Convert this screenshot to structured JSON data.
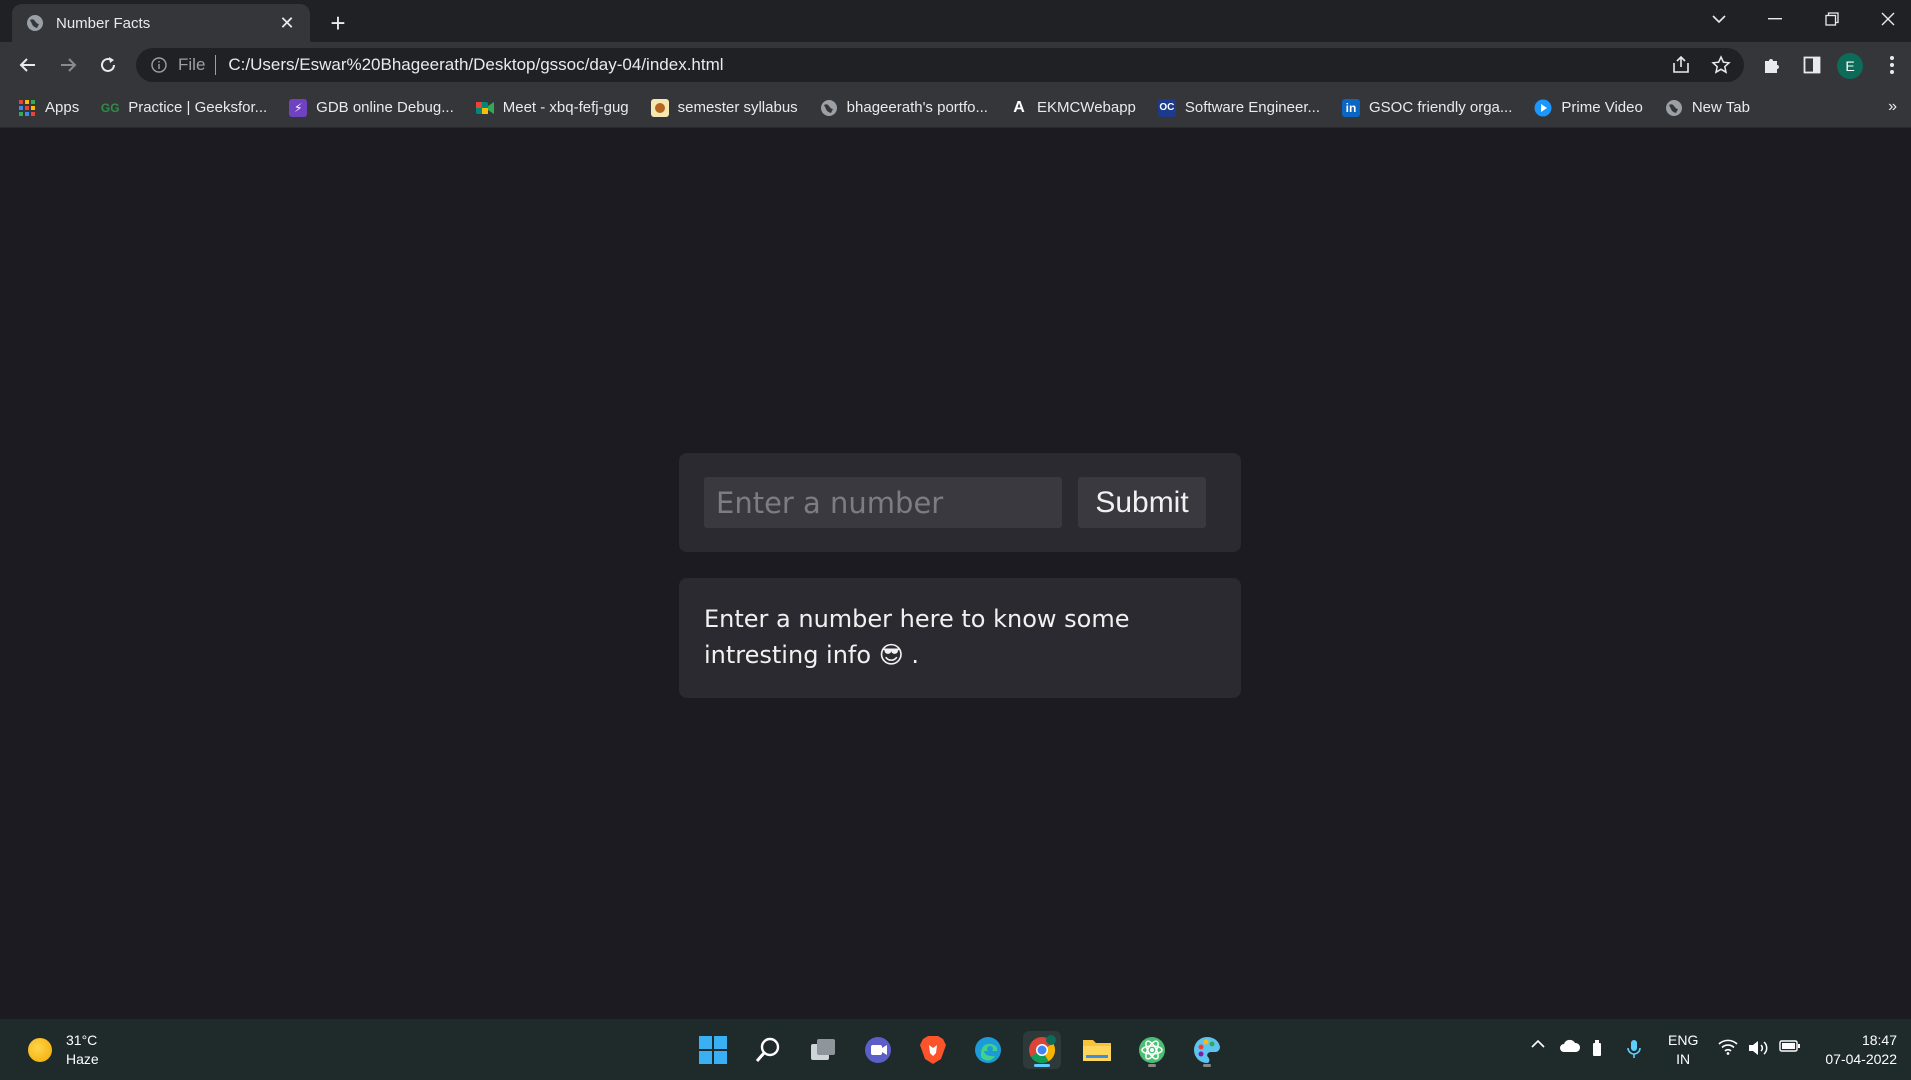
{
  "browser": {
    "tab_title": "Number Facts",
    "address_scheme": "File",
    "address_url": "C:/Users/Eswar%20Bhageerath/Desktop/gssoc/day-04/index.html",
    "profile_initial": "E"
  },
  "bookmarks": [
    {
      "label": "Apps",
      "icon": "apps-grid-icon",
      "color": "#ea4335"
    },
    {
      "label": "Practice | Geeksfor...",
      "icon": "gfg-icon",
      "color": "#2f8d46"
    },
    {
      "label": "GDB online Debug...",
      "icon": "gdb-icon",
      "color": "#6f42c1"
    },
    {
      "label": "Meet - xbq-fefj-gug",
      "icon": "meet-icon",
      "color": "#00897b"
    },
    {
      "label": "semester syllabus",
      "icon": "syllabus-icon",
      "color": "#f4b400"
    },
    {
      "label": "bhageerath's portfo...",
      "icon": "globe-icon",
      "color": "#9aa0a6"
    },
    {
      "label": "EKMCWebapp",
      "icon": "a-logo-icon",
      "color": "#ffffff"
    },
    {
      "label": "Software Engineer...",
      "icon": "oc-icon",
      "color": "#1e3a8a"
    },
    {
      "label": "GSOC friendly orga...",
      "icon": "linkedin-icon",
      "color": "#0a66c2"
    },
    {
      "label": "Prime Video",
      "icon": "prime-video-icon",
      "color": "#1a98ff"
    },
    {
      "label": "New Tab",
      "icon": "globe-icon",
      "color": "#9aa0a6"
    }
  ],
  "page": {
    "input_placeholder": "Enter a number",
    "submit_label": "Submit",
    "info_text": "Enter a number here to know some intresting info 😎 ."
  },
  "taskbar": {
    "temperature": "31°C",
    "condition": "Haze",
    "lang_top": "ENG",
    "lang_bottom": "IN",
    "time": "18:47",
    "date": "07-04-2022"
  }
}
